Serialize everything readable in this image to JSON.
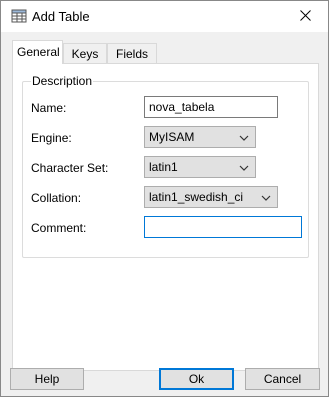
{
  "window": {
    "title": "Add Table",
    "title_icon": "table-icon",
    "close_icon": "close-icon"
  },
  "tabs": [
    {
      "label": "General",
      "active": true
    },
    {
      "label": "Keys",
      "active": false
    },
    {
      "label": "Fields",
      "active": false
    }
  ],
  "description": {
    "legend": "Description",
    "name": {
      "label": "Name:",
      "value": "nova_tabela"
    },
    "engine": {
      "label": "Engine:",
      "value": "MyISAM"
    },
    "charset": {
      "label": "Character Set:",
      "value": "latin1"
    },
    "collation": {
      "label": "Collation:",
      "value": "latin1_swedish_ci"
    },
    "comment": {
      "label": "Comment:",
      "value": ""
    }
  },
  "buttons": {
    "help": "Help",
    "ok": "Ok",
    "cancel": "Cancel"
  },
  "colors": {
    "focus_border": "#0078d7",
    "dialog_bg": "#f0f0f0",
    "panel_bg": "#ffffff"
  }
}
